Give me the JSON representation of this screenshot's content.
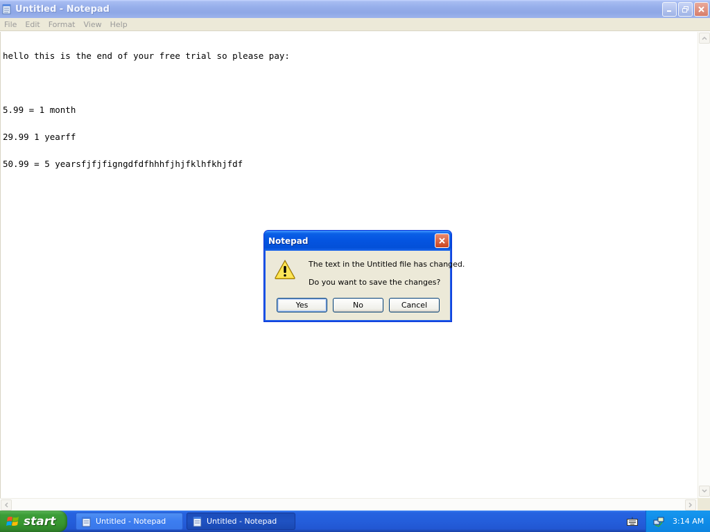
{
  "window": {
    "title": "Untitled - Notepad",
    "menu": [
      "File",
      "Edit",
      "Format",
      "View",
      "Help"
    ]
  },
  "editor": {
    "lines": [
      "hello this is the end of your free trial so please pay:",
      "",
      "5.99 = 1 month",
      "29.99 1 yearff",
      "50.99 = 5 yearsfjfjfigngdfdfhhhfjhjfklhfkhjfdf"
    ]
  },
  "dialog": {
    "title": "Notepad",
    "message1": "The text in the Untitled file has changed.",
    "message2": "Do you want to save the changes?",
    "buttons": {
      "yes": "Yes",
      "no": "No",
      "cancel": "Cancel"
    },
    "icon": "warning-icon"
  },
  "taskbar": {
    "start_label": "start",
    "tasks": [
      "Untitled - Notepad",
      "Untitled - Notepad"
    ],
    "clock": "3:14 AM"
  },
  "colors": {
    "taskbar_blue": "#245edb",
    "start_green": "#37962f",
    "dialog_title_blue": "#0454e0",
    "window_inactive_title": "#96aeea"
  }
}
